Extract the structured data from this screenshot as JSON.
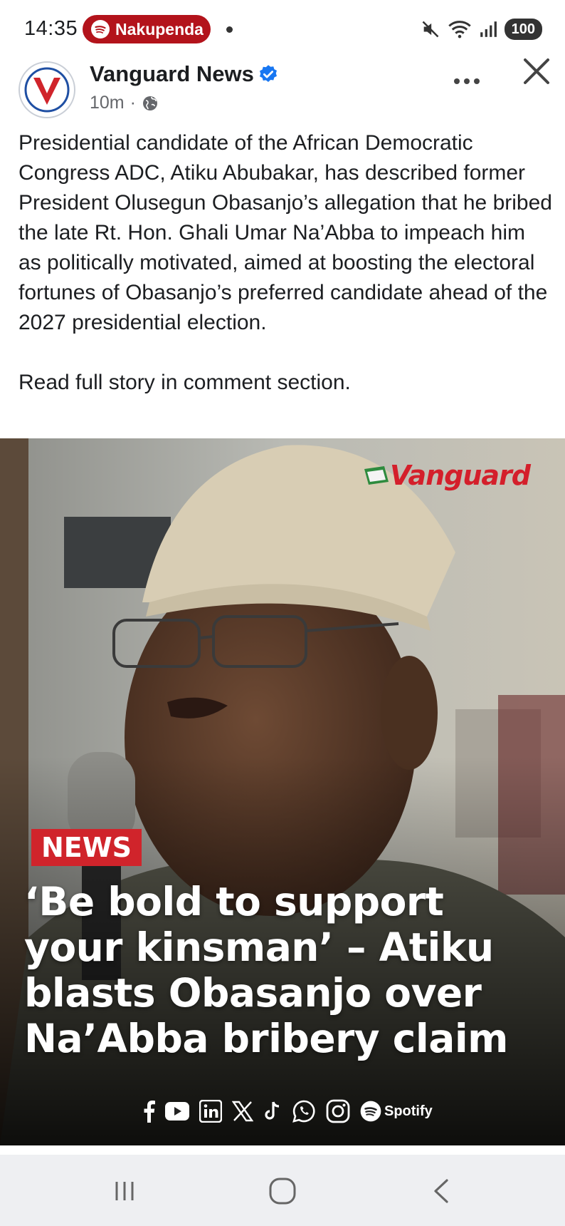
{
  "status_bar": {
    "time": "14:35",
    "media_app": "Nakupenda",
    "battery": "100",
    "icons": [
      "mute-icon",
      "wifi-icon",
      "signal-icon",
      "battery-icon"
    ]
  },
  "post": {
    "page_name": "Vanguard News",
    "verified": true,
    "time_ago": "10m",
    "audience_icon": "globe-icon",
    "text": "Presidential candidate of the African Democratic Congress ADC, Atiku Abubakar, has described former President Olusegun Obasanjo’s allegation that he bribed the late Rt. Hon. Ghali Umar Na’Abba to impeach him as politically motivated, aimed at boosting the electoral fortunes of Obasanjo’s preferred candidate ahead of the 2027 presidential election.",
    "cta": "Read full story in comment section."
  },
  "image": {
    "brand": "Vanguard",
    "badge": "NEWS",
    "headline": "‘Be bold to support your kinsman’ – Atiku blasts Obasanjo over Na’Abba bribery claim",
    "social_icons": [
      "facebook-icon",
      "youtube-icon",
      "linkedin-icon",
      "x-icon",
      "tiktok-icon",
      "whatsapp-icon",
      "instagram-icon",
      "spotify-icon"
    ],
    "spotify_label": "Spotify"
  },
  "nav": {
    "buttons": [
      "recent-apps",
      "home",
      "back"
    ]
  },
  "colors": {
    "brand_red": "#d0242b",
    "verified_blue": "#1877f2",
    "spotify_pill": "#b3131b"
  }
}
